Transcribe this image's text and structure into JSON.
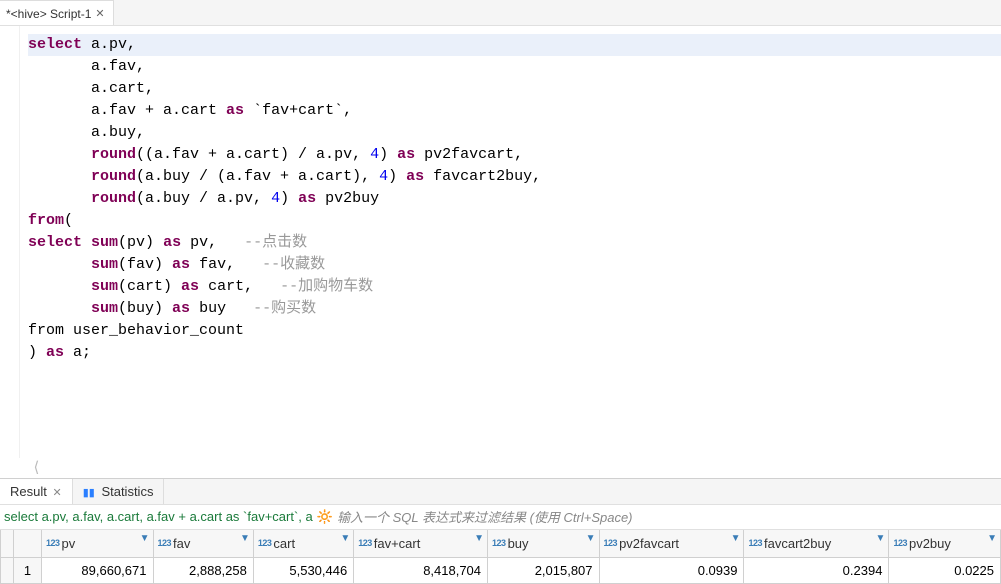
{
  "tab": {
    "title": "*<hive> Script-1"
  },
  "code": {
    "lines": [
      {
        "pre": "",
        "tokens": [
          [
            "kw",
            "select"
          ],
          [
            "",
            " a.pv,"
          ]
        ]
      },
      {
        "pre": "       ",
        "tokens": [
          [
            "",
            "a.fav,"
          ]
        ]
      },
      {
        "pre": "       ",
        "tokens": [
          [
            "",
            "a.cart,"
          ]
        ]
      },
      {
        "pre": "       ",
        "tokens": [
          [
            "",
            "a.fav + a.cart "
          ],
          [
            "kw",
            "as"
          ],
          [
            "",
            " `fav+cart`,"
          ]
        ]
      },
      {
        "pre": "       ",
        "tokens": [
          [
            "",
            "a.buy,"
          ]
        ]
      },
      {
        "pre": "       ",
        "tokens": [
          [
            "fn",
            "round"
          ],
          [
            "",
            "((a.fav + a.cart) / a.pv, "
          ],
          [
            "lit",
            "4"
          ],
          [
            "",
            ") "
          ],
          [
            "kw",
            "as"
          ],
          [
            "",
            " pv2favcart,"
          ]
        ]
      },
      {
        "pre": "       ",
        "tokens": [
          [
            "fn",
            "round"
          ],
          [
            "",
            "(a.buy / (a.fav + a.cart), "
          ],
          [
            "lit",
            "4"
          ],
          [
            "",
            ") "
          ],
          [
            "kw",
            "as"
          ],
          [
            "",
            " favcart2buy,"
          ]
        ]
      },
      {
        "pre": "       ",
        "tokens": [
          [
            "fn",
            "round"
          ],
          [
            "",
            "(a.buy / a.pv, "
          ],
          [
            "lit",
            "4"
          ],
          [
            "",
            ") "
          ],
          [
            "kw",
            "as"
          ],
          [
            "",
            " pv2buy"
          ]
        ]
      },
      {
        "pre": "",
        "tokens": [
          [
            "kw",
            "from"
          ],
          [
            "",
            "("
          ]
        ]
      },
      {
        "pre": "",
        "tokens": [
          [
            "kw",
            "select"
          ],
          [
            "",
            " "
          ],
          [
            "fn",
            "sum"
          ],
          [
            "",
            "(pv) "
          ],
          [
            "kw",
            "as"
          ],
          [
            "",
            " pv,   "
          ],
          [
            "cmt",
            "--点击数"
          ]
        ]
      },
      {
        "pre": "       ",
        "tokens": [
          [
            "fn",
            "sum"
          ],
          [
            "",
            "(fav) "
          ],
          [
            "kw",
            "as"
          ],
          [
            "",
            " fav,   "
          ],
          [
            "cmt",
            "--收藏数"
          ]
        ]
      },
      {
        "pre": "       ",
        "tokens": [
          [
            "fn",
            "sum"
          ],
          [
            "",
            "(cart) "
          ],
          [
            "kw",
            "as"
          ],
          [
            "",
            " cart,   "
          ],
          [
            "cmt",
            "--加购物车数"
          ]
        ]
      },
      {
        "pre": "       ",
        "tokens": [
          [
            "fn",
            "sum"
          ],
          [
            "",
            "(buy) "
          ],
          [
            "kw",
            "as"
          ],
          [
            "",
            " buy   "
          ],
          [
            "cmt",
            "--购买数"
          ]
        ]
      },
      {
        "pre": "",
        "tokens": [
          [
            "",
            "from user_behavior_count"
          ]
        ]
      },
      {
        "pre": "",
        "tokens": [
          [
            "",
            ") "
          ],
          [
            "kw",
            "as"
          ],
          [
            "",
            " a;"
          ]
        ]
      }
    ]
  },
  "bottomTabs": {
    "result": "Result",
    "statistics": "Statistics"
  },
  "filter": {
    "sqlPreview": "select a.pv, a.fav, a.cart, a.fav + a.cart as `fav+cart`, a",
    "placeholder": "输入一个 SQL 表达式来过滤结果 (使用 Ctrl+Space)"
  },
  "chart_data": {
    "type": "table",
    "columns": [
      "pv",
      "fav",
      "cart",
      "fav+cart",
      "buy",
      "pv2favcart",
      "favcart2buy",
      "pv2buy"
    ],
    "rows": [
      {
        "pv": "89,660,671",
        "fav": "2,888,258",
        "cart": "5,530,446",
        "fav+cart": "8,418,704",
        "buy": "2,015,807",
        "pv2favcart": "0.0939",
        "favcart2buy": "0.2394",
        "pv2buy": "0.0225"
      }
    ]
  },
  "rownum": "1",
  "scroll_hint": "⟨"
}
